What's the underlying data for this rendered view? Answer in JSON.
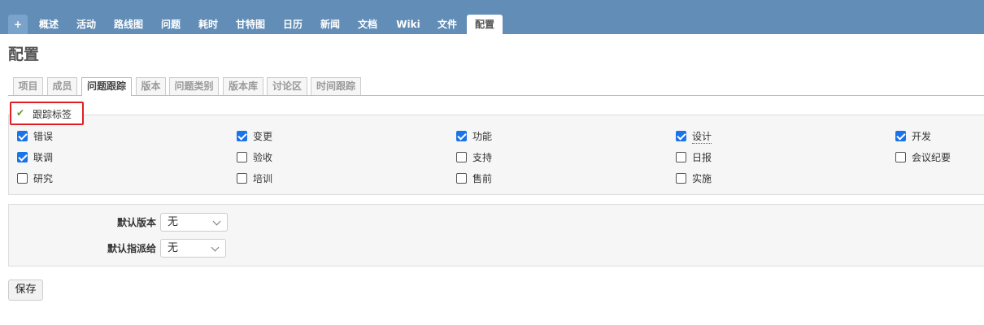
{
  "top_tabs": [
    {
      "label": "+",
      "key": "plus"
    },
    {
      "label": "概述"
    },
    {
      "label": "活动"
    },
    {
      "label": "路线图"
    },
    {
      "label": "问题"
    },
    {
      "label": "耗时"
    },
    {
      "label": "甘特图"
    },
    {
      "label": "日历"
    },
    {
      "label": "新闻"
    },
    {
      "label": "文档"
    },
    {
      "label": "Wiki"
    },
    {
      "label": "文件"
    },
    {
      "label": "配置",
      "selected": true
    }
  ],
  "page_title": "配置",
  "settings_tabs": [
    {
      "label": "项目"
    },
    {
      "label": "成员"
    },
    {
      "label": "问题跟踪",
      "selected": true
    },
    {
      "label": "版本"
    },
    {
      "label": "问题类别"
    },
    {
      "label": "版本库"
    },
    {
      "label": "讨论区"
    },
    {
      "label": "时间跟踪"
    }
  ],
  "trackers_legend": "跟踪标签",
  "trackers": [
    {
      "label": "错误",
      "checked": true
    },
    {
      "label": "变更",
      "checked": true
    },
    {
      "label": "功能",
      "checked": true
    },
    {
      "label": "设计",
      "checked": true
    },
    {
      "label": "开发",
      "checked": true
    },
    {
      "label": "联调",
      "checked": true
    },
    {
      "label": "验收",
      "checked": false
    },
    {
      "label": "支持",
      "checked": false
    },
    {
      "label": "日报",
      "checked": false
    },
    {
      "label": "会议纪要",
      "checked": false
    },
    {
      "label": "研究",
      "checked": false
    },
    {
      "label": "培训",
      "checked": false
    },
    {
      "label": "售前",
      "checked": false
    },
    {
      "label": "实施",
      "checked": false
    }
  ],
  "defaults": {
    "default_version_label": "默认版本",
    "default_version_value": "无",
    "default_assignee_label": "默认指派给",
    "default_assignee_value": "无"
  },
  "save_label": "保存",
  "icons": {
    "legend": "check-icon",
    "select": "chevron-down-icon"
  },
  "colors": {
    "header": "#628db6",
    "checkbox_on": "#1a73e8",
    "highlight": "#e02020",
    "check": "#5aa02c"
  }
}
